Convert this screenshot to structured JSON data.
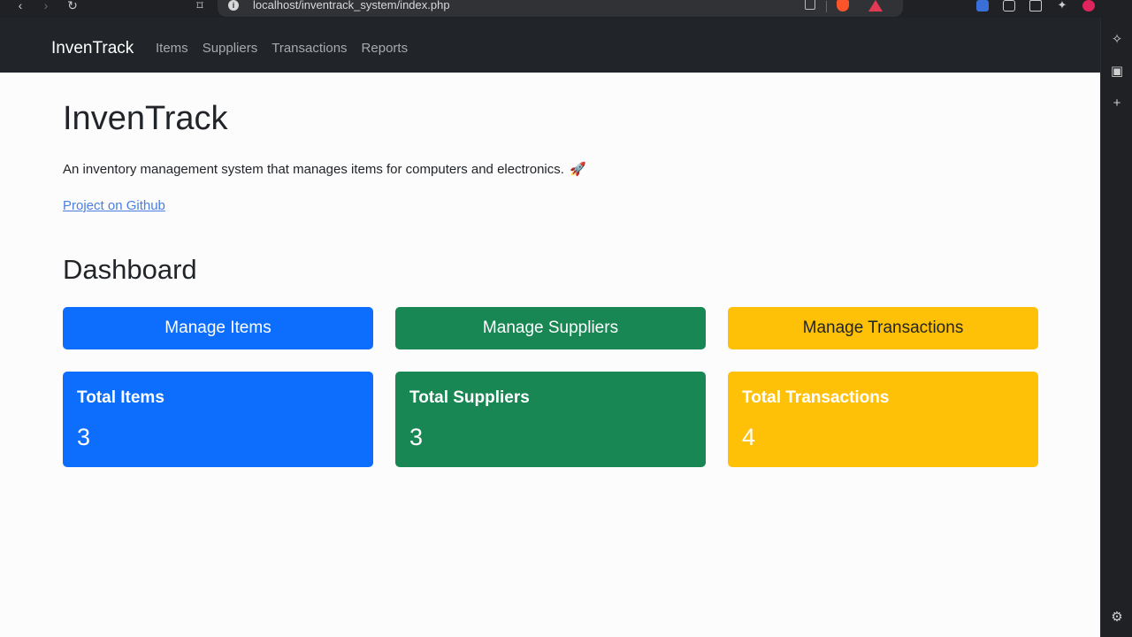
{
  "browser": {
    "url": "localhost/inventrack_system/index.php"
  },
  "navbar": {
    "brand": "InvenTrack",
    "links": [
      "Items",
      "Suppliers",
      "Transactions",
      "Reports"
    ]
  },
  "main": {
    "title": "InvenTrack",
    "description": "An inventory management system that manages items for computers and electronics.",
    "rocket": "🚀",
    "github_link": "Project on Github",
    "dashboard_title": "Dashboard",
    "buttons": [
      {
        "label": "Manage Items",
        "color": "#0d6efd"
      },
      {
        "label": "Manage Suppliers",
        "color": "#198754"
      },
      {
        "label": "Manage Transactions",
        "color": "#ffc107"
      }
    ],
    "cards": [
      {
        "title": "Total Items",
        "value": "3",
        "color": "#0d6efd"
      },
      {
        "title": "Total Suppliers",
        "value": "3",
        "color": "#198754"
      },
      {
        "title": "Total Transactions",
        "value": "4",
        "color": "#ffc107"
      }
    ]
  },
  "icons": {
    "back": "arrow-left-icon",
    "forward": "arrow-right-icon",
    "reload": "reload-icon",
    "bookmark": "bookmark-icon",
    "info": "info-icon",
    "share": "share-icon",
    "brave": "brave-shield-icon",
    "rewards": "brave-rewards-icon",
    "sidebar": [
      "leo-ai-icon",
      "reading-list-icon",
      "add-icon",
      "settings-icon"
    ]
  }
}
